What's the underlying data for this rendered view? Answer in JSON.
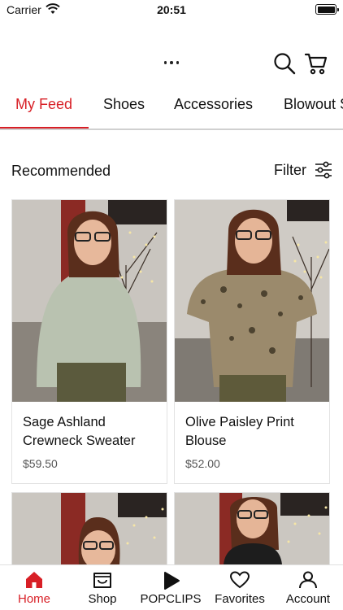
{
  "status_bar": {
    "carrier": "Carrier",
    "time": "20:51"
  },
  "header": {
    "icons": [
      "more-icon",
      "search-icon",
      "cart-icon"
    ]
  },
  "tabs": [
    {
      "label": "My Feed",
      "active": true
    },
    {
      "label": "Shoes",
      "active": false
    },
    {
      "label": "Accessories",
      "active": false
    },
    {
      "label": "Blowout S",
      "active": false
    }
  ],
  "section": {
    "title": "Recommended",
    "filter_label": "Filter"
  },
  "products": [
    {
      "name": "Sage Ashland Crewneck Sweater",
      "price": "$59.50"
    },
    {
      "name": "Olive Paisley Print Blouse",
      "price": "$52.00"
    },
    {
      "name": "",
      "price": ""
    },
    {
      "name": "",
      "price": ""
    }
  ],
  "bottom_nav": [
    {
      "label": "Home",
      "icon": "home-icon",
      "active": true
    },
    {
      "label": "Shop",
      "icon": "shop-icon",
      "active": false
    },
    {
      "label": "POPCLIPS",
      "icon": "play-icon",
      "active": false
    },
    {
      "label": "Favorites",
      "icon": "heart-icon",
      "active": false
    },
    {
      "label": "Account",
      "icon": "person-icon",
      "active": false
    }
  ],
  "colors": {
    "accent": "#d81f26",
    "text": "#111111",
    "divider": "#d0d0d0"
  }
}
